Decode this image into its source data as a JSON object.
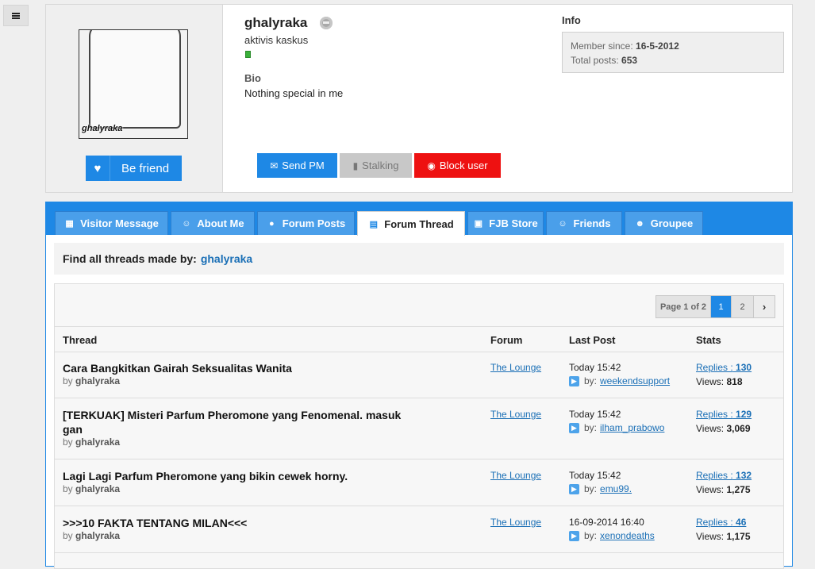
{
  "profile": {
    "username": "ghalyraka",
    "user_title": "aktivis kaskus",
    "avatar_tag": "ghalyraka",
    "bio_heading": "Bio",
    "bio_text": "Nothing special in me",
    "be_friend_label": "Be friend",
    "send_pm_label": "Send PM",
    "stalking_label": "Stalking",
    "block_label": "Block user",
    "info_heading": "Info",
    "member_since_label": "Member since:",
    "member_since": "16-5-2012",
    "total_posts_label": "Total posts:",
    "total_posts": "653"
  },
  "tabs": [
    {
      "label": "Visitor Message",
      "icon": "message-icon"
    },
    {
      "label": "About Me",
      "icon": "user-icon"
    },
    {
      "label": "Forum Posts",
      "icon": "chat-bubble-icon"
    },
    {
      "label": "Forum Thread",
      "icon": "calendar-icon",
      "active": true
    },
    {
      "label": "FJB Store",
      "icon": "cart-icon"
    },
    {
      "label": "Friends",
      "icon": "user-icon"
    },
    {
      "label": "Groupee",
      "icon": "group-icon"
    }
  ],
  "find": {
    "label": "Find all threads made by:",
    "username": "ghalyraka"
  },
  "pager": {
    "info": "Page 1 of 2",
    "pages": [
      "1",
      "2"
    ],
    "current": "1"
  },
  "columns": {
    "thread": "Thread",
    "forum": "Forum",
    "last_post": "Last Post",
    "stats": "Stats"
  },
  "threads": [
    {
      "title": "Cara Bangkitkan Gairah Seksualitas Wanita",
      "by_label": "by",
      "author": "ghalyraka",
      "forum": "The Lounge",
      "last_post_time": "Today 15:42",
      "last_by_label": "by:",
      "last_by": "weekendsupport",
      "replies_label": "Replies :",
      "replies": "130",
      "views_label": "Views:",
      "views": "818"
    },
    {
      "title": "[TERKUAK] Misteri Parfum Pheromone yang Fenomenal. masuk gan",
      "by_label": "by",
      "author": "ghalyraka",
      "forum": "The Lounge",
      "last_post_time": "Today 15:42",
      "last_by_label": "by:",
      "last_by": "ilham_prabowo",
      "replies_label": "Replies :",
      "replies": "129",
      "views_label": "Views:",
      "views": "3,069"
    },
    {
      "title": "Lagi Lagi Parfum Pheromone yang bikin cewek horny.",
      "by_label": "by",
      "author": "ghalyraka",
      "forum": "The Lounge",
      "last_post_time": "Today 15:42",
      "last_by_label": "by:",
      "last_by": "emu99.",
      "replies_label": "Replies :",
      "replies": "132",
      "views_label": "Views:",
      "views": "1,275"
    },
    {
      "title": ">>>10 FAKTA TENTANG MILAN<<<",
      "by_label": "by",
      "author": "ghalyraka",
      "forum": "The Lounge",
      "last_post_time": "16-09-2014 16:40",
      "last_by_label": "by:",
      "last_by": "xenondeaths",
      "replies_label": "Replies :",
      "replies": "46",
      "views_label": "Views:",
      "views": "1,175"
    }
  ]
}
